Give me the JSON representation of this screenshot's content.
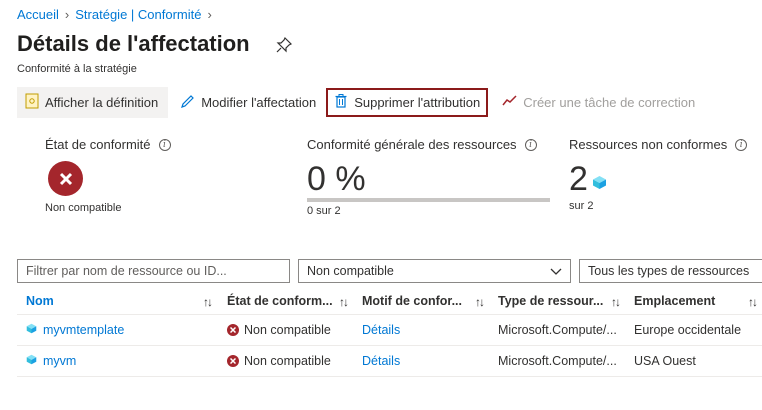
{
  "breadcrumb": {
    "home": "Accueil",
    "parent": "Stratégie | Conformité"
  },
  "page": {
    "title": "Détails de l'affectation",
    "subtitle": "Conformité à la stratégie"
  },
  "toolbar": {
    "view_definition": "Afficher la définition",
    "edit_assignment": "Modifier l'affectation",
    "delete_assignment": "Supprimer l'attribution",
    "create_remediation": "Créer une tâche de correction"
  },
  "metrics": {
    "compliance_state": {
      "label": "État de conformité",
      "value": "Non compatible"
    },
    "overall_compliance": {
      "label": "Conformité générale des ressources",
      "value": "0 %",
      "detail": "0 sur 2",
      "fraction": 0
    },
    "noncompliant_resources": {
      "label": "Ressources non conformes",
      "value": "2",
      "detail": "sur 2"
    }
  },
  "filters": {
    "search_placeholder": "Filtrer par nom de ressource ou ID...",
    "compliance_selected": "Non compatible",
    "types_selected": "Tous les types de ressources"
  },
  "table": {
    "headers": [
      "Nom",
      "État de conform...",
      "Motif de confor...",
      "Type de ressour...",
      "Emplacement"
    ],
    "rows": [
      {
        "name": "myvmtemplate",
        "state": "Non compatible",
        "reason": "Détails",
        "type": "Microsoft.Compute/...",
        "location": "Europe occidentale"
      },
      {
        "name": "myvm",
        "state": "Non compatible",
        "reason": "Détails",
        "type": "Microsoft.Compute/...",
        "location": "USA Ouest"
      }
    ]
  },
  "colors": {
    "accent": "#0078d4",
    "error": "#a4262c",
    "highlight_border": "#8b1a1a"
  }
}
